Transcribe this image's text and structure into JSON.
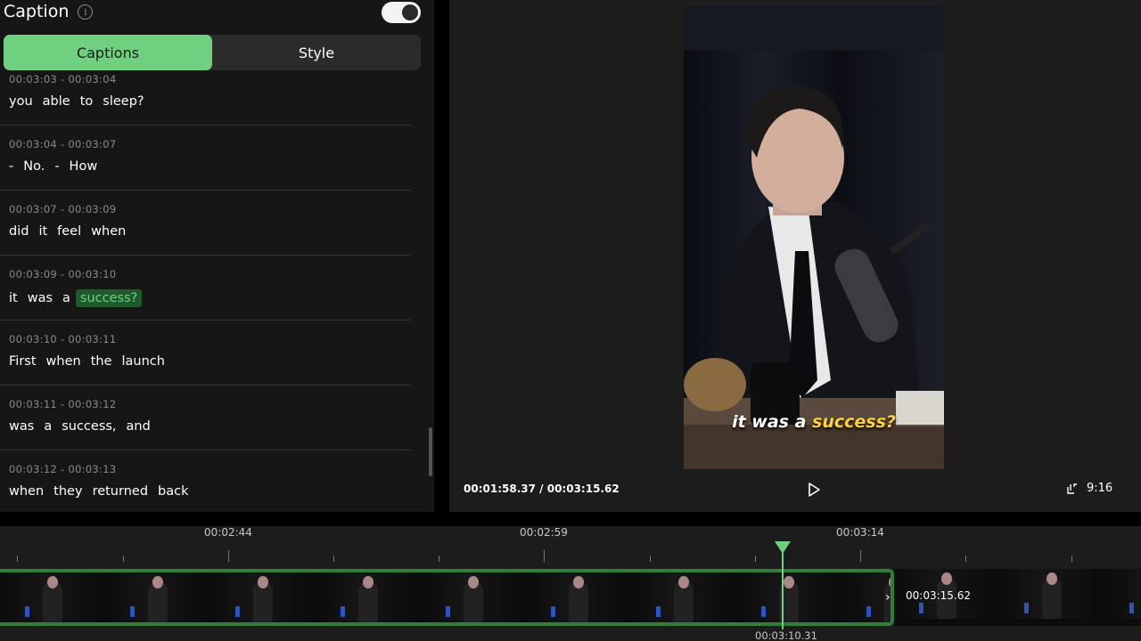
{
  "caption_panel": {
    "title": "Caption",
    "info_icon": "i",
    "toggle_on": true,
    "tabs": [
      {
        "label": "Captions",
        "active": true
      },
      {
        "label": "Style",
        "active": false
      }
    ]
  },
  "captions": [
    {
      "time": "00:03:03 - 00:03:04",
      "words": [
        "you",
        "able",
        "to",
        "sleep?"
      ]
    },
    {
      "time": "00:03:04 - 00:03:07",
      "words": [
        "-",
        "No.",
        "-",
        "How"
      ]
    },
    {
      "time": "00:03:07 - 00:03:09",
      "words": [
        "did",
        "it",
        "feel",
        "when"
      ]
    },
    {
      "time": "00:03:09 - 00:03:10",
      "words": [
        "it",
        "was",
        "a",
        "success?"
      ],
      "highlight_index": 3
    },
    {
      "time": "00:03:10 - 00:03:11",
      "words": [
        "First",
        "when",
        "the",
        "launch"
      ]
    },
    {
      "time": "00:03:11 - 00:03:12",
      "words": [
        "was",
        "a",
        "success,",
        "and"
      ]
    },
    {
      "time": "00:03:12 - 00:03:13",
      "words": [
        "when",
        "they",
        "returned",
        "back"
      ]
    }
  ],
  "preview": {
    "subtitle_plain": "it was a",
    "subtitle_highlight": "success?",
    "current_time": "00:01:58.37",
    "separator": "/",
    "total_time": "00:03:15.62",
    "aspect_ratio": "9:16",
    "colors": {
      "accent": "#6fd07f",
      "subtitle_highlight": "#ffd23a"
    }
  },
  "timeline": {
    "labels": [
      "00:02:44",
      "00:02:59",
      "00:03:14"
    ],
    "duration_label": "00:03:15.62",
    "playhead_time": "00:03:10.31"
  }
}
